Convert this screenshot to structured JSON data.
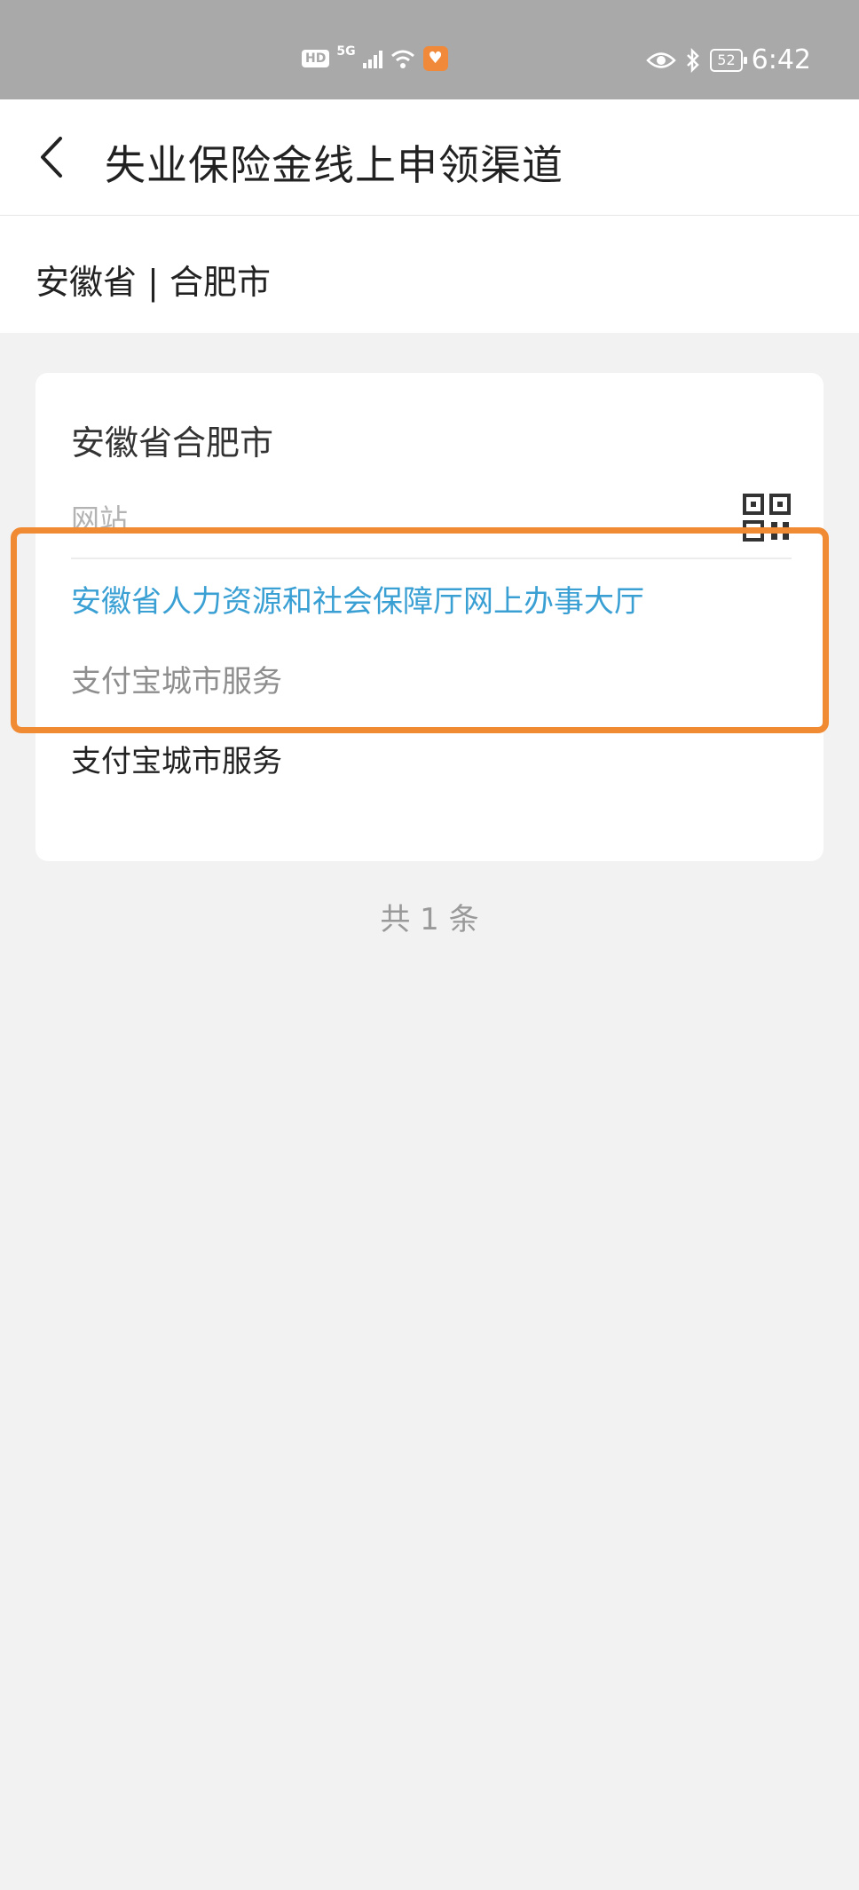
{
  "status_bar": {
    "hd_badge": "HD",
    "network": "5G",
    "battery": "52",
    "time": "6:42",
    "icons": [
      "hd-icon",
      "signal-icon",
      "wifi-icon",
      "health-app-icon",
      "eye-icon",
      "bluetooth-icon",
      "battery-icon"
    ]
  },
  "nav": {
    "title": "失业保险金线上申领渠道",
    "back_icon": "chevron-left-icon"
  },
  "location": {
    "text": "安徽省 | 合肥市"
  },
  "card": {
    "title": "安徽省合肥市",
    "field_label": "网站",
    "qr_icon": "qr-code-icon",
    "site_link": "安徽省人力资源和社会保障厅网上办事大厅",
    "service_gray": "支付宝城市服务",
    "service_dark": "支付宝城市服务"
  },
  "footer": {
    "count_text": "共 1 条"
  },
  "colors": {
    "status_bar": "#a9a9a9",
    "link": "#3aa0d4",
    "highlight": "#f08a33",
    "background": "#f2f2f2"
  }
}
